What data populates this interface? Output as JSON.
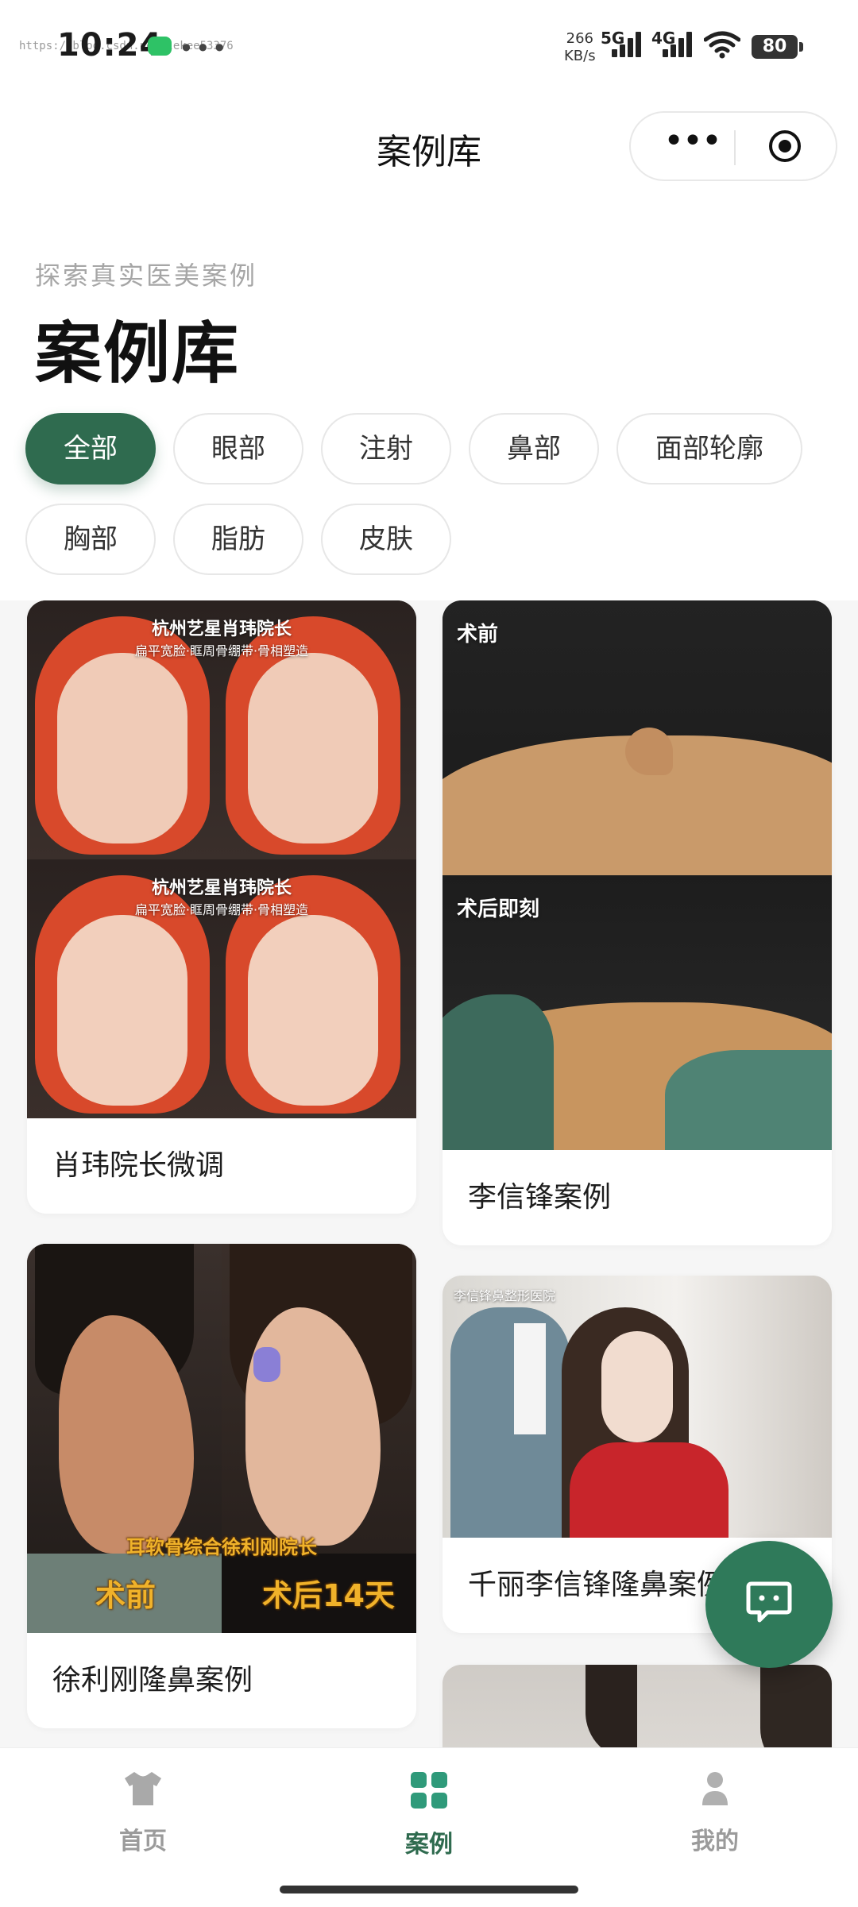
{
  "status": {
    "time": "10:24",
    "watermark": "https://blog.csdn.net/lekee53376",
    "speed_value": "266",
    "speed_unit": "KB/s",
    "net1": "5G",
    "net2": "4G",
    "battery": "80"
  },
  "nav": {
    "title": "案例库",
    "more_label": "•••"
  },
  "header": {
    "subtitle": "探索真实医美案例",
    "title": "案例库"
  },
  "filters": [
    {
      "label": "全部",
      "active": true
    },
    {
      "label": "眼部"
    },
    {
      "label": "注射"
    },
    {
      "label": "鼻部"
    },
    {
      "label": "面部轮廓"
    },
    {
      "label": "胸部"
    },
    {
      "label": "脂肪"
    },
    {
      "label": "皮肤"
    }
  ],
  "cards": [
    {
      "caption": "肖玮院长微调",
      "overlay_title_1": "杭州艺星肖玮院长",
      "overlay_sub_1": "扁平宽脸·眶周骨绷带·骨相塑造",
      "overlay_title_2": "杭州艺星肖玮院长",
      "overlay_sub_2": "扁平宽脸·眶周骨绷带·骨相塑造"
    },
    {
      "caption": "李信锋案例",
      "overlay_before": "术前",
      "overlay_after": "术后即刻"
    },
    {
      "caption": "徐利刚隆鼻案例",
      "overlay_title": "耳软骨综合徐利刚院长",
      "overlay_before": "术前",
      "overlay_after": "术后14天"
    },
    {
      "caption": "千丽李信锋隆鼻案例",
      "overlay_logo": "李信锋鼻整形医院"
    }
  ],
  "tabs": [
    {
      "label": "首页",
      "icon": "shirt-icon"
    },
    {
      "label": "案例",
      "icon": "grid-icon",
      "active": true
    },
    {
      "label": "我的",
      "icon": "person-icon"
    }
  ],
  "colors": {
    "accent": "#2f6b4f",
    "fab": "#2f7a5a",
    "tab_active": "#2f6b4f",
    "tab_inactive": "#9b9b9b"
  }
}
